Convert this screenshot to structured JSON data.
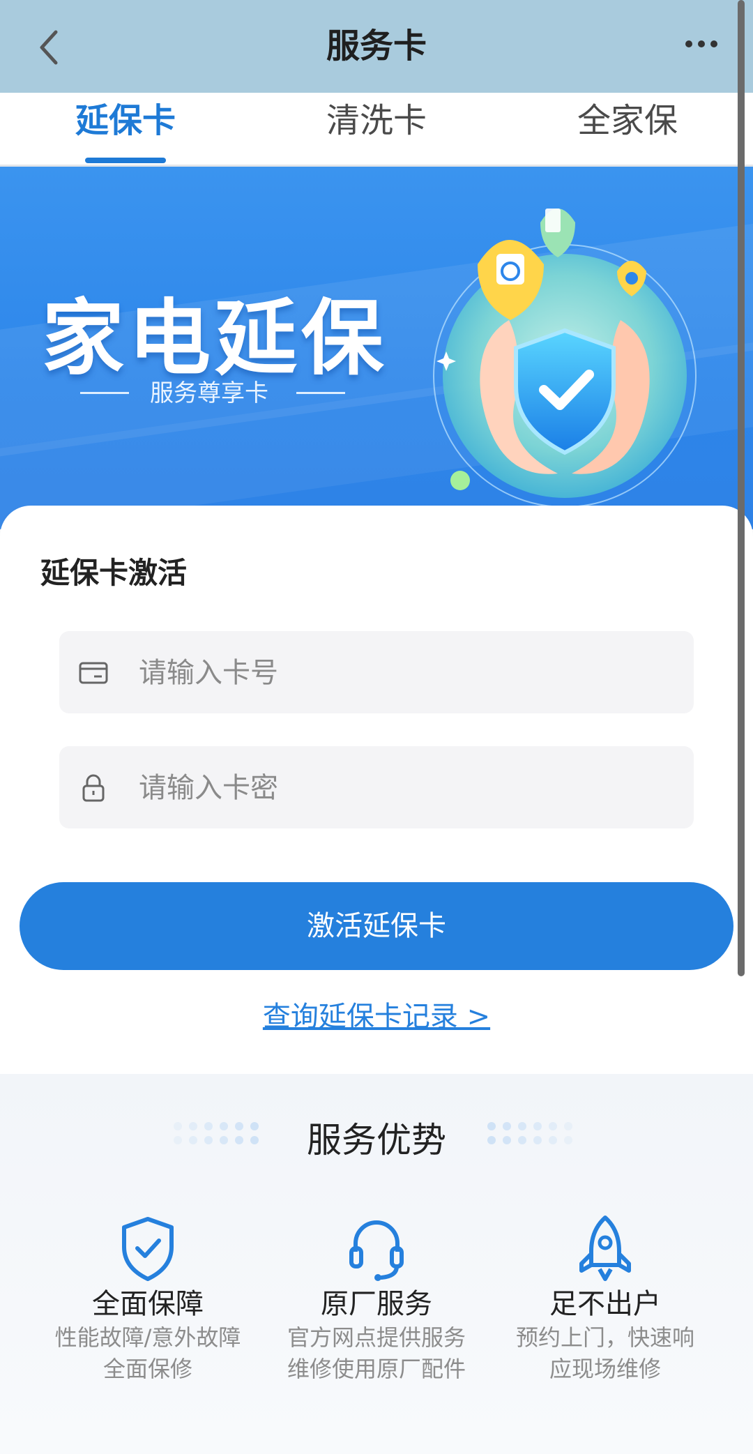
{
  "header": {
    "title": "服务卡",
    "back_icon": "chevron-left-icon",
    "more_icon": "more-dots-icon"
  },
  "tabs": [
    {
      "label": "延保卡",
      "active": true
    },
    {
      "label": "清洗卡",
      "active": false
    },
    {
      "label": "全家保",
      "active": false
    }
  ],
  "banner": {
    "title": "家电延保",
    "subtitle": "服务尊享卡"
  },
  "activation": {
    "title": "延保卡激活",
    "card_number": {
      "placeholder": "请输入卡号",
      "value": "",
      "icon": "card-icon"
    },
    "card_password": {
      "placeholder": "请输入卡密",
      "value": "",
      "icon": "lock-icon"
    },
    "submit_label": "激活延保卡",
    "query_link": "查询延保卡记录 >"
  },
  "advantages": {
    "title": "服务优势",
    "items": [
      {
        "title": "全面保障",
        "desc_line1": "性能故障/意外故障",
        "desc_line2": "全面保修",
        "icon": "shield-check-icon"
      },
      {
        "title": "原厂服务",
        "desc_line1": "官方网点提供服务",
        "desc_line2": "维修使用原厂配件",
        "icon": "headset-icon"
      },
      {
        "title": "足不出户",
        "desc_line1": "预约上门，快速响",
        "desc_line2": "应现场维修",
        "icon": "rocket-icon"
      }
    ]
  },
  "colors": {
    "accent": "#2580dd",
    "header_bg": "#a9cbdd",
    "banner_bg": "#3b94ef"
  }
}
